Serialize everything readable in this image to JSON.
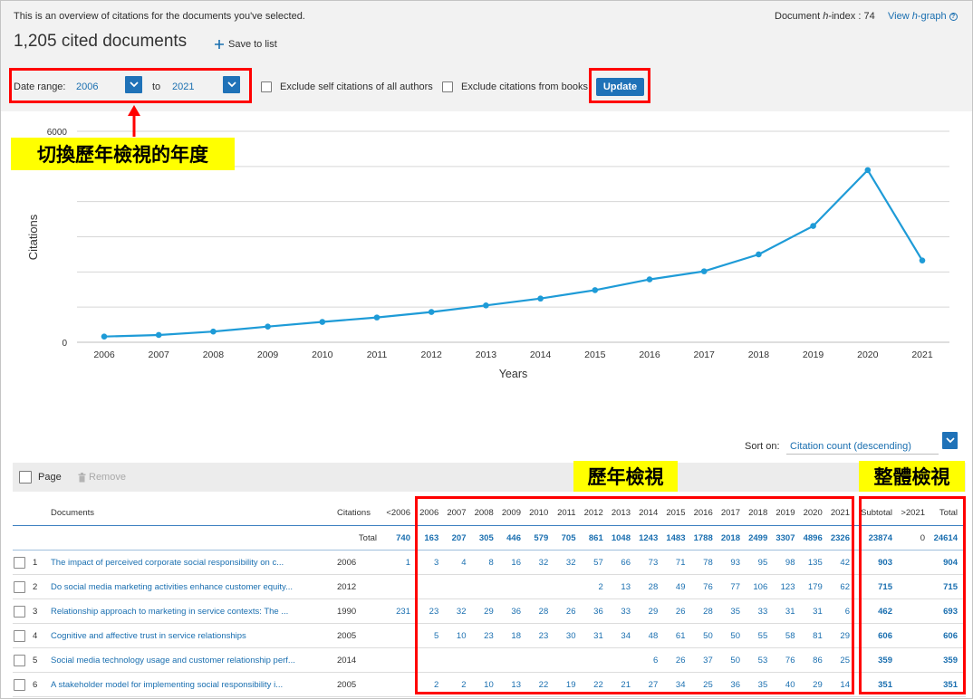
{
  "header": {
    "overview_text": "This is an overview of citations for the documents you've selected.",
    "h_index": {
      "prefix": "Document ",
      "italic": "h",
      "suffix": "-index : ",
      "value": "74"
    },
    "view_hgraph": {
      "prefix": "View ",
      "italic": "h",
      "suffix": "-graph"
    },
    "cited_documents": "1,205 cited documents",
    "save_to_list": "Save to list"
  },
  "filters": {
    "date_range_label": "Date range:",
    "from_year": "2006",
    "to_label": "to",
    "to_year": "2021",
    "exclude_self_citations": "Exclude self citations of all authors",
    "exclude_self_citations_checked": false,
    "exclude_books": "Exclude citations from books",
    "exclude_books_checked": false,
    "update_button": "Update"
  },
  "annotations": {
    "switch_years_label": "切換歷年檢視的年度",
    "yearly_view_label": "歷年檢視",
    "overall_view_label": "整體檢視"
  },
  "chart_data": {
    "type": "line",
    "x": [
      2006,
      2007,
      2008,
      2009,
      2010,
      2011,
      2012,
      2013,
      2014,
      2015,
      2016,
      2017,
      2018,
      2019,
      2020,
      2021
    ],
    "values": [
      163,
      207,
      305,
      446,
      579,
      705,
      861,
      1048,
      1243,
      1483,
      1788,
      2018,
      2499,
      3307,
      4896,
      2326
    ],
    "xlabel": "Years",
    "ylabel": "Citations",
    "ylim": [
      0,
      6000
    ],
    "yticks_labeled": [
      6000,
      0
    ],
    "grid": true,
    "markers": true
  },
  "sort": {
    "label": "Sort on:",
    "value": "Citation count (descending)"
  },
  "selection": {
    "page_label": "Page",
    "remove_label": "Remove"
  },
  "table": {
    "headers": {
      "documents": "Documents",
      "citations": "Citations",
      "before": "<2006",
      "subtotal": "Subtotal",
      "after": ">2021",
      "total": "Total"
    },
    "years": [
      "2006",
      "2007",
      "2008",
      "2009",
      "2010",
      "2011",
      "2012",
      "2013",
      "2014",
      "2015",
      "2016",
      "2017",
      "2018",
      "2019",
      "2020",
      "2021"
    ],
    "total_row": {
      "label": "Total",
      "before": 740,
      "by_year": [
        163,
        207,
        305,
        446,
        579,
        705,
        861,
        1048,
        1243,
        1483,
        1788,
        2018,
        2499,
        3307,
        4896,
        2326
      ],
      "subtotal": 23874,
      "after": 0,
      "total": 24614
    },
    "rows": [
      {
        "index": "1",
        "title": "The impact of perceived corporate social responsibility on c...",
        "year": "2006",
        "before": 1,
        "by_year": [
          3,
          4,
          8,
          16,
          32,
          32,
          57,
          66,
          73,
          71,
          78,
          93,
          95,
          98,
          135,
          42
        ],
        "subtotal": 903,
        "after": null,
        "total": 904
      },
      {
        "index": "2",
        "title": "Do social media marketing activities enhance customer equity...",
        "year": "2012",
        "before": null,
        "by_year": [
          null,
          null,
          null,
          null,
          null,
          null,
          2,
          13,
          28,
          49,
          76,
          77,
          106,
          123,
          179,
          62
        ],
        "subtotal": 715,
        "after": null,
        "total": 715
      },
      {
        "index": "3",
        "title": "Relationship approach to marketing in service contexts: The ...",
        "year": "1990",
        "before": 231,
        "by_year": [
          23,
          32,
          29,
          36,
          28,
          26,
          36,
          33,
          29,
          26,
          28,
          35,
          33,
          31,
          31,
          6
        ],
        "subtotal": 462,
        "after": null,
        "total": 693
      },
      {
        "index": "4",
        "title": "Cognitive and affective trust in service relationships",
        "year": "2005",
        "before": null,
        "by_year": [
          5,
          10,
          23,
          18,
          23,
          30,
          31,
          34,
          48,
          61,
          50,
          50,
          55,
          58,
          81,
          29
        ],
        "subtotal": 606,
        "after": null,
        "total": 606
      },
      {
        "index": "5",
        "title": "Social media technology usage and customer relationship perf...",
        "year": "2014",
        "before": null,
        "by_year": [
          null,
          null,
          null,
          null,
          null,
          null,
          null,
          null,
          6,
          26,
          37,
          50,
          53,
          76,
          86,
          25
        ],
        "subtotal": 359,
        "after": null,
        "total": 359
      },
      {
        "index": "6",
        "title": "A stakeholder model for implementing social responsibility i...",
        "year": "2005",
        "before": null,
        "by_year": [
          2,
          2,
          10,
          13,
          22,
          19,
          22,
          21,
          27,
          34,
          25,
          36,
          35,
          40,
          29,
          14
        ],
        "subtotal": 351,
        "after": null,
        "total": 351
      }
    ]
  },
  "icons": {
    "save_to_list": "plus-icon",
    "hgraph_help": "help-icon",
    "dropdowns": "chevron-down-icon",
    "remove": "trash-icon",
    "annotation_pointer": "arrow-up-icon"
  },
  "colors": {
    "link_blue": "#1a6fb0",
    "button_blue": "#1f72b8",
    "chart_line": "#1e9bd7",
    "annotation_red": "#ff0000",
    "annotation_yellow": "#ffff00"
  }
}
